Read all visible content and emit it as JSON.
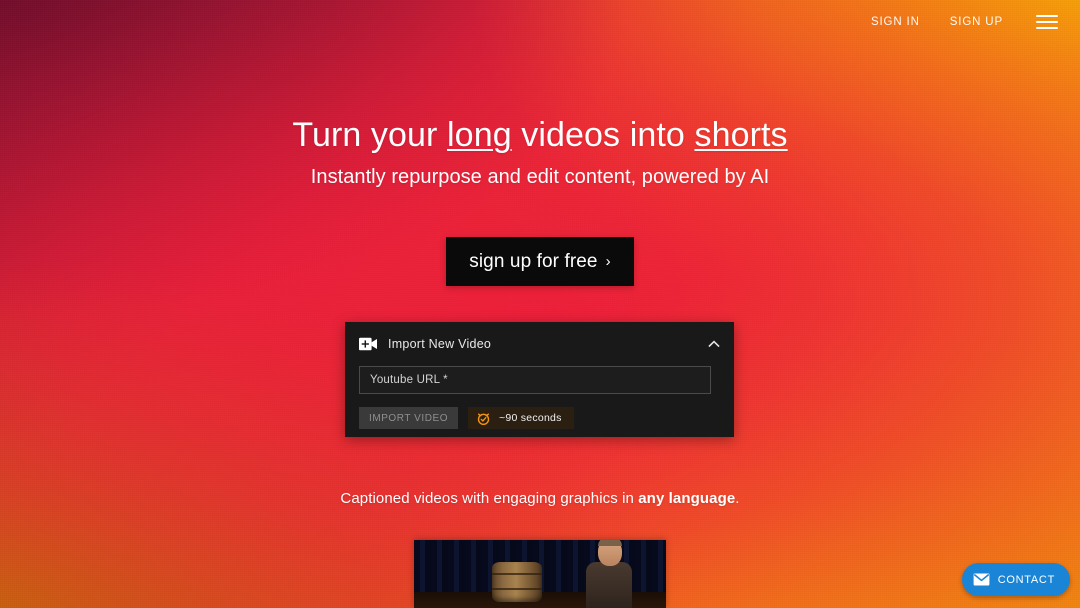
{
  "nav": {
    "sign_in": "SIGN IN",
    "sign_up": "SIGN UP",
    "menu_icon": "hamburger-menu-icon"
  },
  "hero": {
    "headline_part1": "Turn your ",
    "headline_emph1": "long",
    "headline_part2": " videos into ",
    "headline_emph2": "shorts",
    "subheadline": "Instantly repurpose and edit content, powered by AI",
    "cta_label": "sign up for free",
    "cta_chevron": "›"
  },
  "import_panel": {
    "icon": "video-add-icon",
    "title": "Import New Video",
    "collapse_icon": "chevron-up-icon",
    "url_placeholder": "Youtube URL *",
    "url_value": "",
    "import_button_label": "IMPORT VIDEO",
    "duration_icon": "alarm-clock-icon",
    "duration_text": "~90 seconds"
  },
  "caption": {
    "text_before": "Captioned videos with engaging graphics in ",
    "text_bold": "any language",
    "text_after": "."
  },
  "video_thumbnail": {
    "description": "speaker on stage with wooden barrel"
  },
  "contact": {
    "icon": "envelope-icon",
    "label": "CONTACT"
  },
  "colors": {
    "gradient_start": "#8c1430",
    "gradient_mid": "#e0243c",
    "gradient_end": "#f7a90b",
    "cta_background": "#0a0a0a",
    "panel_background": "#191919",
    "accent_orange": "#f59310",
    "contact_blue": "#1a85d6"
  }
}
